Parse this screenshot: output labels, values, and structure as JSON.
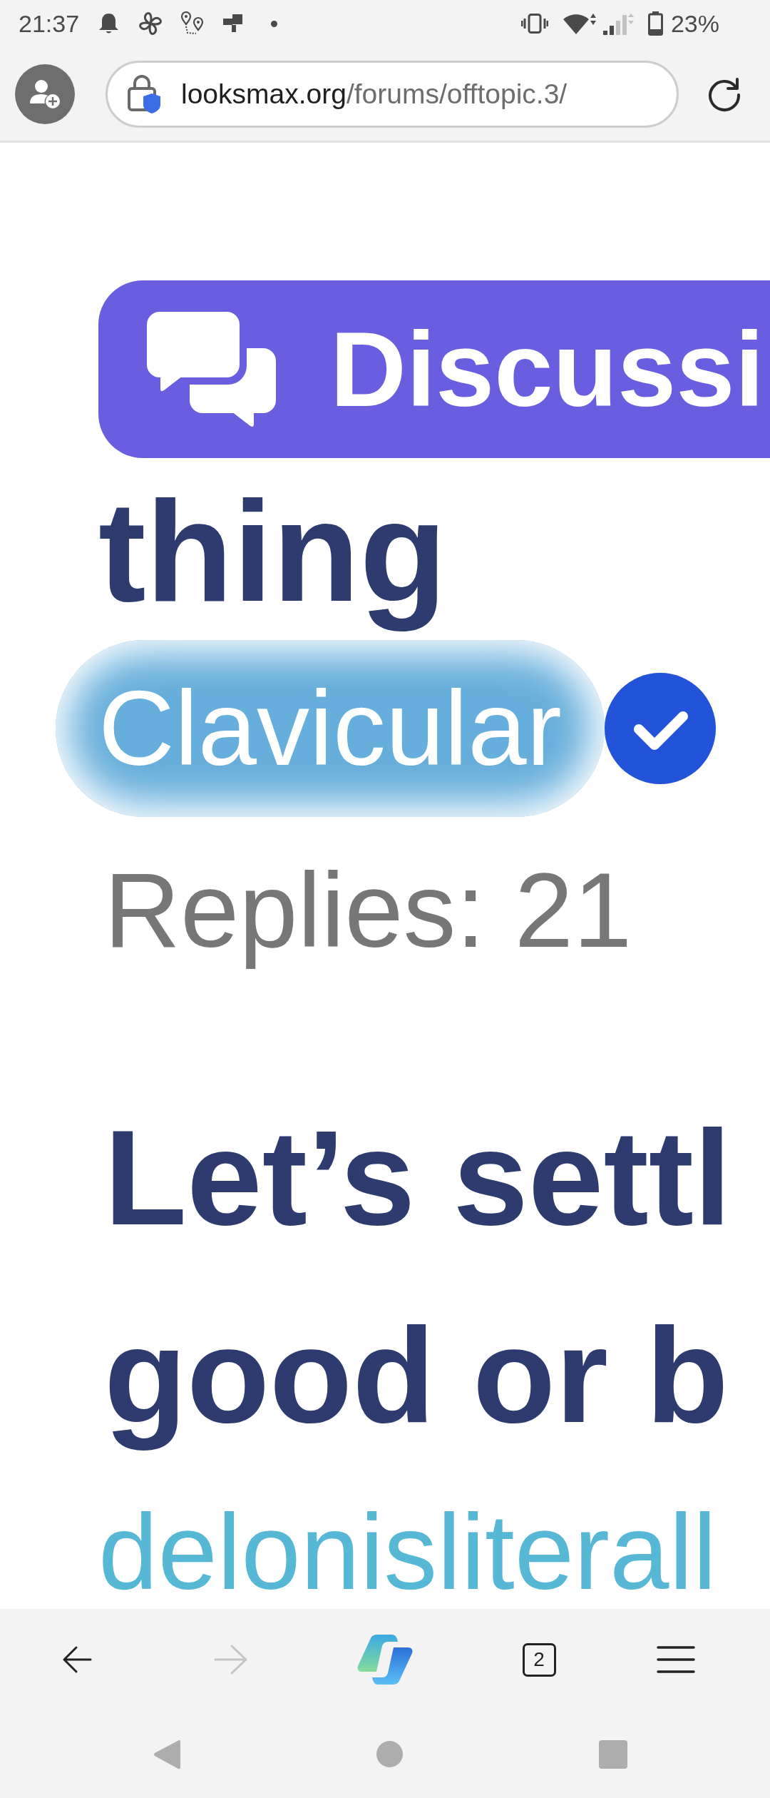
{
  "status_bar": {
    "time": "21:37",
    "battery": "23%"
  },
  "toolbar": {
    "url_domain": "looksmax.org",
    "url_path": "/forums/offtopic.3/"
  },
  "threads": [
    {
      "prefix": "Discussi",
      "title_lines": [
        "thing"
      ],
      "author": "Clavicular",
      "verified": true,
      "replies": "Replies: 21"
    },
    {
      "title_lines": [
        "Let’s settl",
        "good or b"
      ],
      "author": "delonisliterall"
    }
  ],
  "bottom_bar": {
    "nav_buttons": [
      {
        "kind": "back",
        "disabled": false
      },
      {
        "kind": "forward",
        "disabled": true
      },
      {
        "kind": "assistant",
        "disabled": false
      },
      {
        "kind": "tabs",
        "label": "2",
        "disabled": false
      },
      {
        "kind": "menu",
        "disabled": false
      }
    ]
  }
}
